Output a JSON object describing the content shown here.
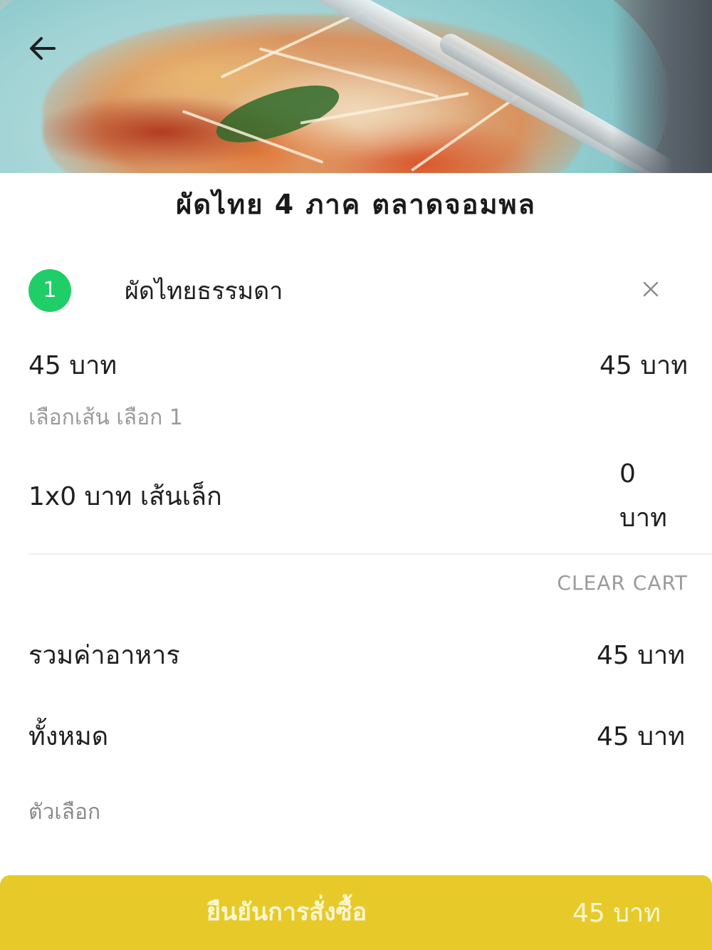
{
  "store": {
    "title": "ผัดไทย 4 ภาค ตลาดจอมพล"
  },
  "cart_item": {
    "quantity": "1",
    "name": "ผัดไทยธรรมดา",
    "unit_price": "45 บาท",
    "line_total": "45 บาท",
    "option_group_label": "เลือกเส้น เลือก 1",
    "option_line": "1x0 บาท  เส้นเล็ก",
    "option_price_value": "0",
    "option_price_unit": "บาท"
  },
  "actions": {
    "clear_cart": "CLEAR CART"
  },
  "summary": {
    "food_total_label": "รวมค่าอาหาร",
    "food_total_value": "45 บาท",
    "grand_total_label": "ทั้งหมด",
    "grand_total_value": "45 บาท",
    "options_label": "ตัวเลือก"
  },
  "confirm": {
    "label": "ยืนยันการสั่งซื้อ",
    "price": "45 บาท"
  },
  "icons": {
    "back": "arrow-left-icon",
    "remove": "close-icon"
  },
  "colors": {
    "badge": "#1fce67",
    "confirm_bar": "#e7ca2a"
  }
}
